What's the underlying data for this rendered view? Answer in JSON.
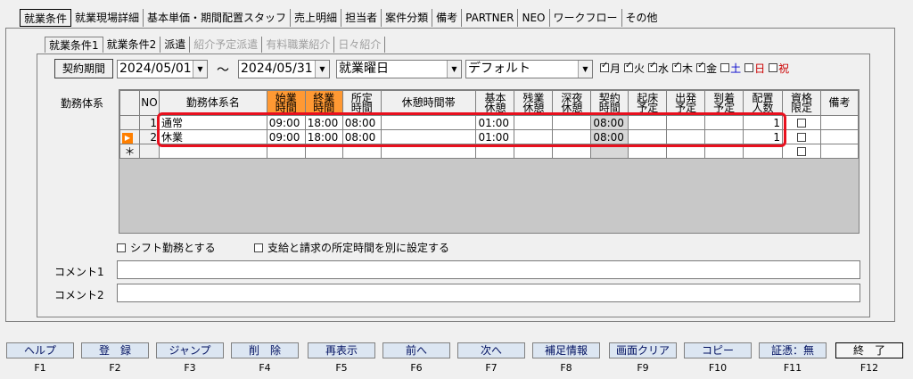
{
  "top_tabs": [
    "就業条件",
    "就業現場詳細",
    "基本単価・期間配置スタッフ",
    "売上明細",
    "担当者",
    "案件分類",
    "備考",
    "PARTNER",
    "NEO",
    "ワークフロー",
    "その他"
  ],
  "sub_tabs": [
    {
      "label": "就業条件1",
      "state": "active"
    },
    {
      "label": "就業条件2",
      "state": "normal"
    },
    {
      "label": "派遣",
      "state": "normal"
    },
    {
      "label": "紹介予定派遣",
      "state": "disabled"
    },
    {
      "label": "有料職業紹介",
      "state": "disabled"
    },
    {
      "label": "日々紹介",
      "state": "disabled"
    }
  ],
  "contract": {
    "button_label": "契約期間",
    "start_date": "2024/05/01",
    "tilde": "～",
    "end_date": "2024/05/31",
    "workday_type": "就業曜日",
    "calendar": "デフォルト"
  },
  "days": [
    {
      "label": "月",
      "checked": true,
      "color": "#000000"
    },
    {
      "label": "火",
      "checked": true,
      "color": "#000000"
    },
    {
      "label": "水",
      "checked": true,
      "color": "#000000"
    },
    {
      "label": "木",
      "checked": true,
      "color": "#000000"
    },
    {
      "label": "金",
      "checked": true,
      "color": "#000000"
    },
    {
      "label": "土",
      "checked": false,
      "color": "#0000cc"
    },
    {
      "label": "日",
      "checked": false,
      "color": "#cc0000"
    },
    {
      "label": "祝",
      "checked": false,
      "color": "#cc0000"
    }
  ],
  "grid": {
    "section_label": "勤務体系",
    "headers": [
      "NO",
      "勤務体系名",
      "始業\n時間",
      "終業\n時間",
      "所定\n時間",
      "休憩時間帯",
      "基本\n休憩",
      "残業\n休憩",
      "深夜\n休憩",
      "契約\n時間",
      "起床\n予定",
      "出発\n予定",
      "到着\n予定",
      "配置\n人数",
      "資格\n限定",
      "備考"
    ],
    "rows": [
      {
        "no": "1",
        "name": "通常",
        "start": "09:00",
        "end": "18:00",
        "scheduled": "08:00",
        "break_band": "",
        "basic_break": "01:00",
        "ot_break": "",
        "night_break": "",
        "contract": "08:00",
        "wake": "",
        "depart": "",
        "arrive": "",
        "staff": "1",
        "qualified": false,
        "note": ""
      },
      {
        "no": "2",
        "name": "休業",
        "start": "09:00",
        "end": "18:00",
        "scheduled": "08:00",
        "break_band": "",
        "basic_break": "01:00",
        "ot_break": "",
        "night_break": "",
        "contract": "08:00",
        "wake": "",
        "depart": "",
        "arrive": "",
        "staff": "1",
        "qualified": false,
        "note": ""
      }
    ],
    "new_row_marker": "＊",
    "current_marker": "▶"
  },
  "options": {
    "shift_label": "シフト勤務とする",
    "separate_label": "支給と請求の所定時間を別に設定する"
  },
  "comments": {
    "comment1_label": "コメント1",
    "comment2_label": "コメント2",
    "comment1_value": "",
    "comment2_value": ""
  },
  "fkeys": [
    {
      "label": "ヘルプ",
      "key": "F1"
    },
    {
      "label": "登　録",
      "key": "F2"
    },
    {
      "label": "ジャンプ",
      "key": "F3"
    },
    {
      "label": "削　除",
      "key": "F4"
    },
    {
      "label": "再表示",
      "key": "F5"
    },
    {
      "label": "前へ",
      "key": "F6"
    },
    {
      "label": "次へ",
      "key": "F7"
    },
    {
      "label": "補足情報",
      "key": "F8"
    },
    {
      "label": "画面クリア",
      "key": "F9"
    },
    {
      "label": "コピー",
      "key": "F10"
    },
    {
      "label": "証憑：無",
      "key": "F11"
    },
    {
      "label": "終　了",
      "key": "F12"
    }
  ]
}
